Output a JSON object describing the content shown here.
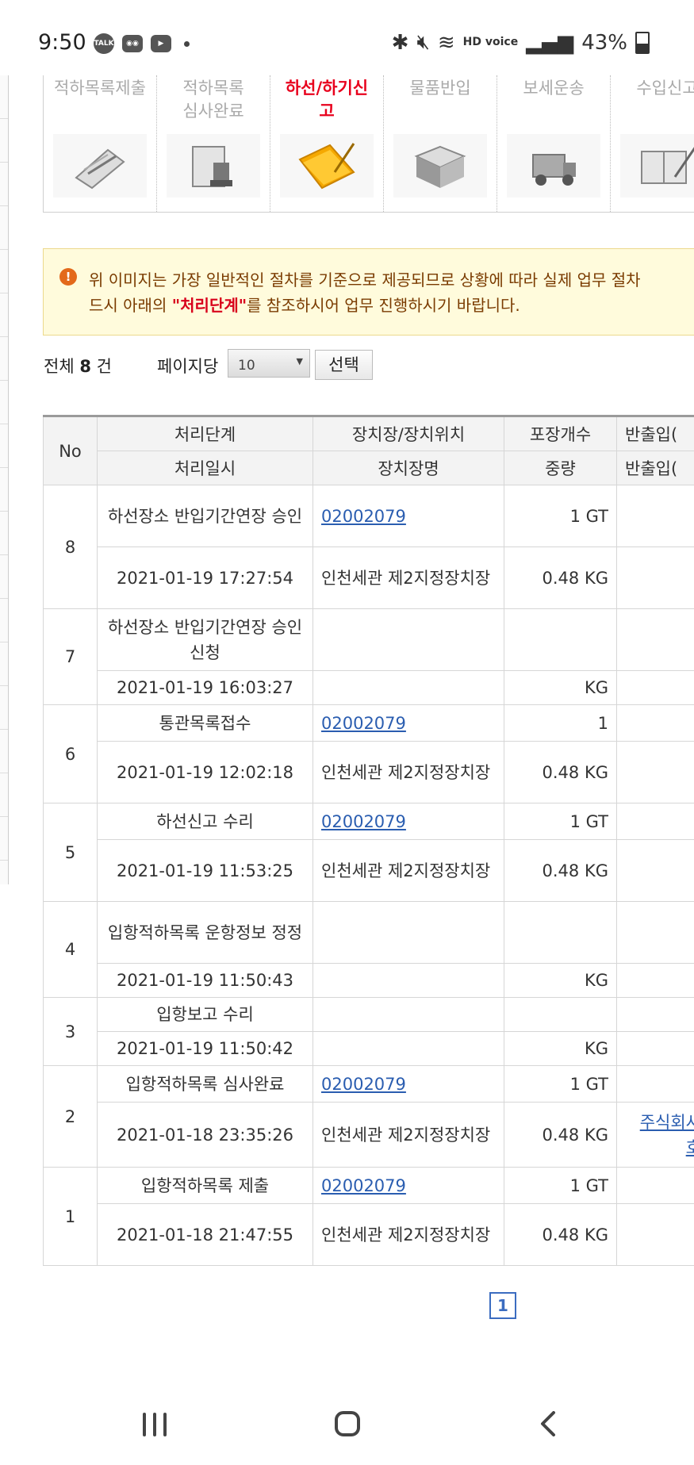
{
  "status_bar": {
    "time": "9:50",
    "left_icons": [
      "talk-icon",
      "discord-icon",
      "youtube-icon",
      "dot-icon"
    ],
    "hd_voice": "HD voice",
    "battery": "43%"
  },
  "steps": [
    {
      "label": "적하목록제출",
      "icon": "clipboard-pen-icon",
      "active": false
    },
    {
      "label": "적하목록\n심사완료",
      "icon": "document-stamp-icon",
      "active": false
    },
    {
      "label": "하선/하기신\n고",
      "icon": "folder-pen-icon",
      "active": true
    },
    {
      "label": "물품반입",
      "icon": "boxes-icon",
      "active": false
    },
    {
      "label": "보세운송",
      "icon": "truck-icon",
      "active": false
    },
    {
      "label": "수입신고",
      "icon": "book-pen-icon",
      "active": false
    }
  ],
  "notice": {
    "line1": "위 이미지는 가장 일반적인 절차를 기준으로 제공되므로 상황에 따라 실제 업무 절차",
    "line2_pre": "드시 아래의 ",
    "line2_highlight": "\"처리단계\"",
    "line2_post": "를 참조하시어 업무 진행하시기 바랍니다."
  },
  "paging": {
    "total_label": "전체",
    "total_count": "8",
    "total_unit": "건",
    "per_page_label": "페이지당",
    "per_page_value": "10",
    "select_button": "선택",
    "current_page": "1"
  },
  "table": {
    "headers": {
      "no": "No",
      "step": "처리단계",
      "datetime": "처리일시",
      "location": "장치장/장치위치",
      "location_name": "장치장명",
      "packages": "포장개수",
      "weight": "중량",
      "inout1": "반출입(",
      "inout2": "반출입("
    },
    "rows": [
      {
        "no": "8",
        "step": "하선장소 반입기간연장 승인",
        "datetime": "2021-01-19 17:27:54",
        "location": "02002079",
        "location_name": "인천세관 제2지정장치장",
        "packages": "1 GT",
        "weight": "0.48 KG",
        "extra": ""
      },
      {
        "no": "7",
        "step": "하선장소 반입기간연장 승인신청",
        "datetime": "2021-01-19 16:03:27",
        "location": "",
        "location_name": "",
        "packages": "",
        "weight": "KG",
        "extra": ""
      },
      {
        "no": "6",
        "step": "통관목록접수",
        "datetime": "2021-01-19 12:02:18",
        "location": "02002079",
        "location_name": "인천세관 제2지정장치장",
        "packages": "1",
        "weight": "0.48 KG",
        "extra": ""
      },
      {
        "no": "5",
        "step": "하선신고 수리",
        "datetime": "2021-01-19 11:53:25",
        "location": "02002079",
        "location_name": "인천세관 제2지정장치장",
        "packages": "1 GT",
        "weight": "0.48 KG",
        "extra": ""
      },
      {
        "no": "4",
        "step": "입항적하목록 운항정보 정정",
        "datetime": "2021-01-19 11:50:43",
        "location": "",
        "location_name": "",
        "packages": "",
        "weight": "KG",
        "extra": ""
      },
      {
        "no": "3",
        "step": "입항보고 수리",
        "datetime": "2021-01-19 11:50:42",
        "location": "",
        "location_name": "",
        "packages": "",
        "weight": "KG",
        "extra": ""
      },
      {
        "no": "2",
        "step": "입항적하목록 심사완료",
        "datetime": "2021-01-18 23:35:26",
        "location": "02002079",
        "location_name": "인천세관 제2지정장치장",
        "packages": "1 GT",
        "weight": "0.48 KG",
        "extra": "주식회사\n호"
      },
      {
        "no": "1",
        "step": "입항적하목록 제출",
        "datetime": "2021-01-18 21:47:55",
        "location": "02002079",
        "location_name": "인천세관 제2지정장치장",
        "packages": "1 GT",
        "weight": "0.48 KG",
        "extra": ""
      }
    ]
  },
  "colors": {
    "active_step": "#e8001c",
    "link": "#2a5db0",
    "notice_bg": "#fffbdc",
    "notice_text": "#7a3b00"
  }
}
